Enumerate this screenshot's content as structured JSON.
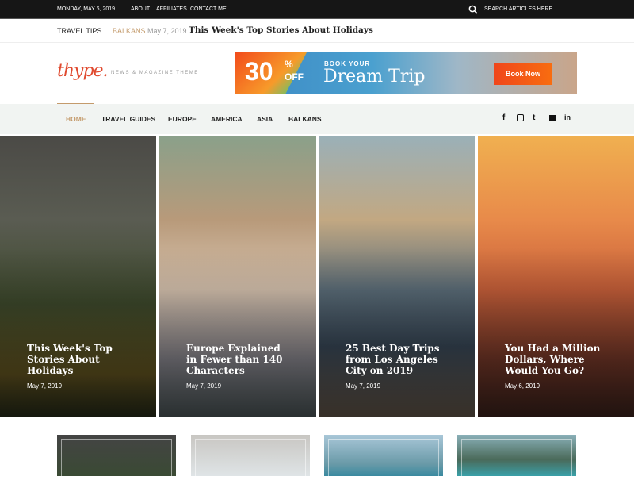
{
  "topbar": {
    "date": "Monday, May 6, 2019",
    "links": [
      "About",
      "Affiliates",
      "Contact Me"
    ],
    "search_placeholder": "Search articles here..."
  },
  "ticker": {
    "label": "Travel Tips",
    "category": "Balkans",
    "date": "May 7, 2019",
    "headline": "This Week's Top Stories About Holidays"
  },
  "header": {
    "logo": "thype.",
    "tagline": "NEWS & MAGAZINE THEME"
  },
  "ad": {
    "percent": "30",
    "percent_sign": "%",
    "off": "OFF",
    "book_your": "BOOK YOUR",
    "dream_trip": "Dream Trip",
    "button": "Book Now"
  },
  "nav": {
    "items": [
      "Home",
      "Travel Guides",
      "Europe",
      "America",
      "Asia",
      "Balkans"
    ],
    "active": "Home",
    "active_color": "#c49b6c",
    "social_icons": [
      "facebook-icon",
      "instagram-icon",
      "twitter-icon",
      "email-icon",
      "linkedin-icon"
    ]
  },
  "hero": [
    {
      "title": "This Week's Top Stories About Holidays",
      "date": "May 7, 2019"
    },
    {
      "title": "Europe Explained in Fewer than 140 Characters",
      "date": "May 7, 2019"
    },
    {
      "title": "25 Best Day Trips from Los Angeles City on 2019",
      "date": "May 7, 2019"
    },
    {
      "title": "You Had a Million Dollars, Where Would You Go?",
      "date": "May 6, 2019"
    }
  ],
  "colors": {
    "logo": "#e04a2f",
    "topbar": "#161616",
    "nav_bg": "#f1f4f2",
    "accent": "#c49b6c"
  }
}
